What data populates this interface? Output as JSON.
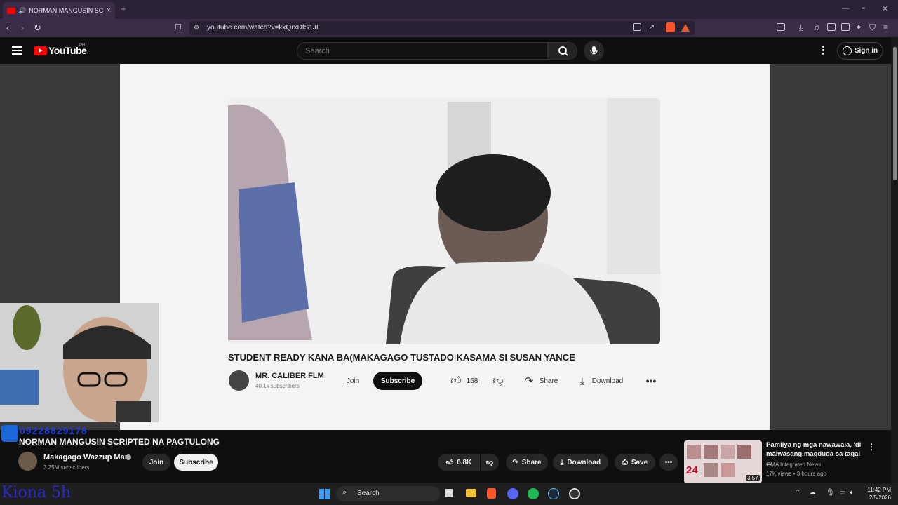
{
  "browser": {
    "tab_title": "NORMAN MANGUSIN SCRIP",
    "url": "youtube.com/watch?v=kxQrxDfS1JI",
    "new_tab": "+",
    "close_tab": "×"
  },
  "youtube": {
    "logo_text": "YouTube",
    "country_code": "PH",
    "search_placeholder": "Search",
    "sign_in": "Sign in"
  },
  "video_frame": {
    "title": "STUDENT READY KANA BA(MAKAGAGO TUSTADO KASAMA SI SUSAN YANCE",
    "channel": "MR. CALIBER FLM",
    "subscribers": "40.1k subscribers",
    "join": "Join",
    "subscribe": "Subscribe",
    "likes": "168",
    "share": "Share",
    "download": "Download"
  },
  "overlay": {
    "donation_number": "09228829178",
    "watermark": "Kiona 5h"
  },
  "video": {
    "title": "NORMAN MANGUSIN SCRIPTED NA PAGTULONG",
    "channel": "Makagago Wazzup Man",
    "subscribers": "3.25M subscribers",
    "join": "Join",
    "subscribe": "Subscribe",
    "likes": "6.8K",
    "share": "Share",
    "download": "Download",
    "save": "Save"
  },
  "recommendation": {
    "title": "Pamilya ng mga nawawala, 'di maiwasang magduda sa tagal ...",
    "channel": "GMA Integrated News",
    "meta": "17K views • 3 hours ago",
    "duration": "3:57",
    "thumb_badge": "24"
  },
  "taskbar": {
    "search": "Search",
    "time": "11:42 PM",
    "date": "2/5/2026"
  },
  "colors": {
    "accent_red": "#ff0000",
    "browser_chrome": "#2b2136",
    "youtube_bg": "#0f0f0f"
  }
}
